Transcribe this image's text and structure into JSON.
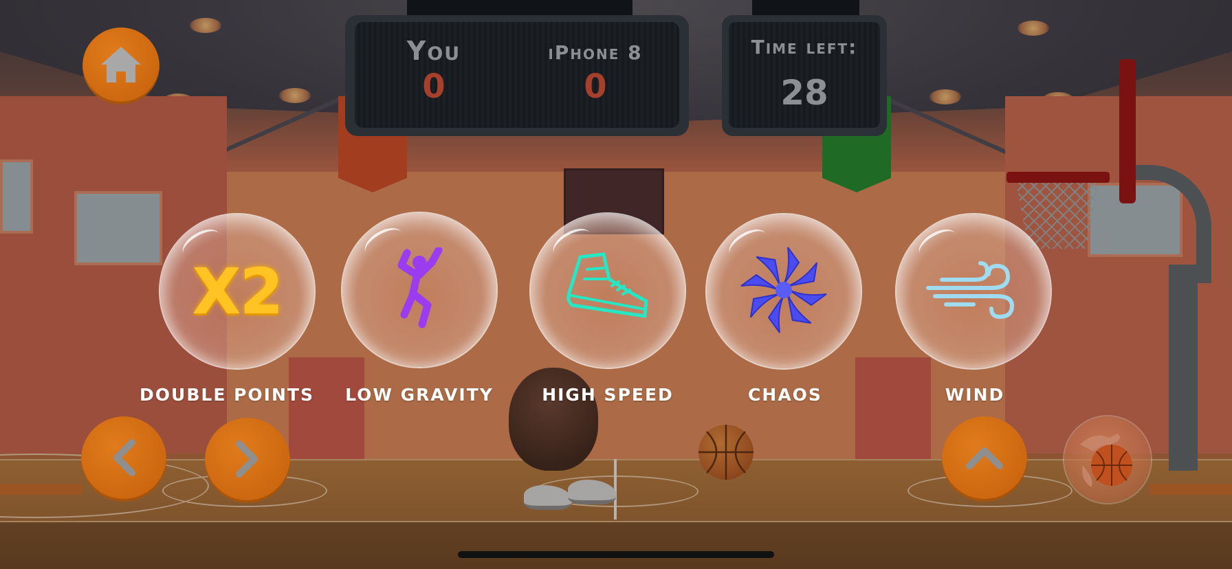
{
  "scoreboard": {
    "player_name": "You",
    "player_score": "0",
    "opponent_name": "iPhone 8",
    "opponent_score": "0"
  },
  "timer": {
    "label": "Time left:",
    "value": "28"
  },
  "powerups": [
    {
      "label": "DOUBLE POINTS",
      "icon": "x2-icon",
      "icon_text": "X2",
      "color": "#ffc423"
    },
    {
      "label": "LOW GRAVITY",
      "icon": "jumping-figure-icon",
      "color": "#9b3cf0"
    },
    {
      "label": "HIGH SPEED",
      "icon": "sneaker-icon",
      "color": "#26e6c4"
    },
    {
      "label": "CHAOS",
      "icon": "spiral-star-icon",
      "color": "#4a4cf0"
    },
    {
      "label": "WIND",
      "icon": "wind-icon",
      "color": "#9fdcf2"
    }
  ],
  "controls": {
    "home": "home-icon",
    "left": "chevron-left-icon",
    "right": "chevron-right-icon",
    "jump": "chevron-up-icon",
    "shoot": "hand-ball-icon"
  },
  "colors": {
    "button_orange": "#d86d12",
    "score_red": "#a5402c",
    "board_bg": "#1b2024"
  }
}
